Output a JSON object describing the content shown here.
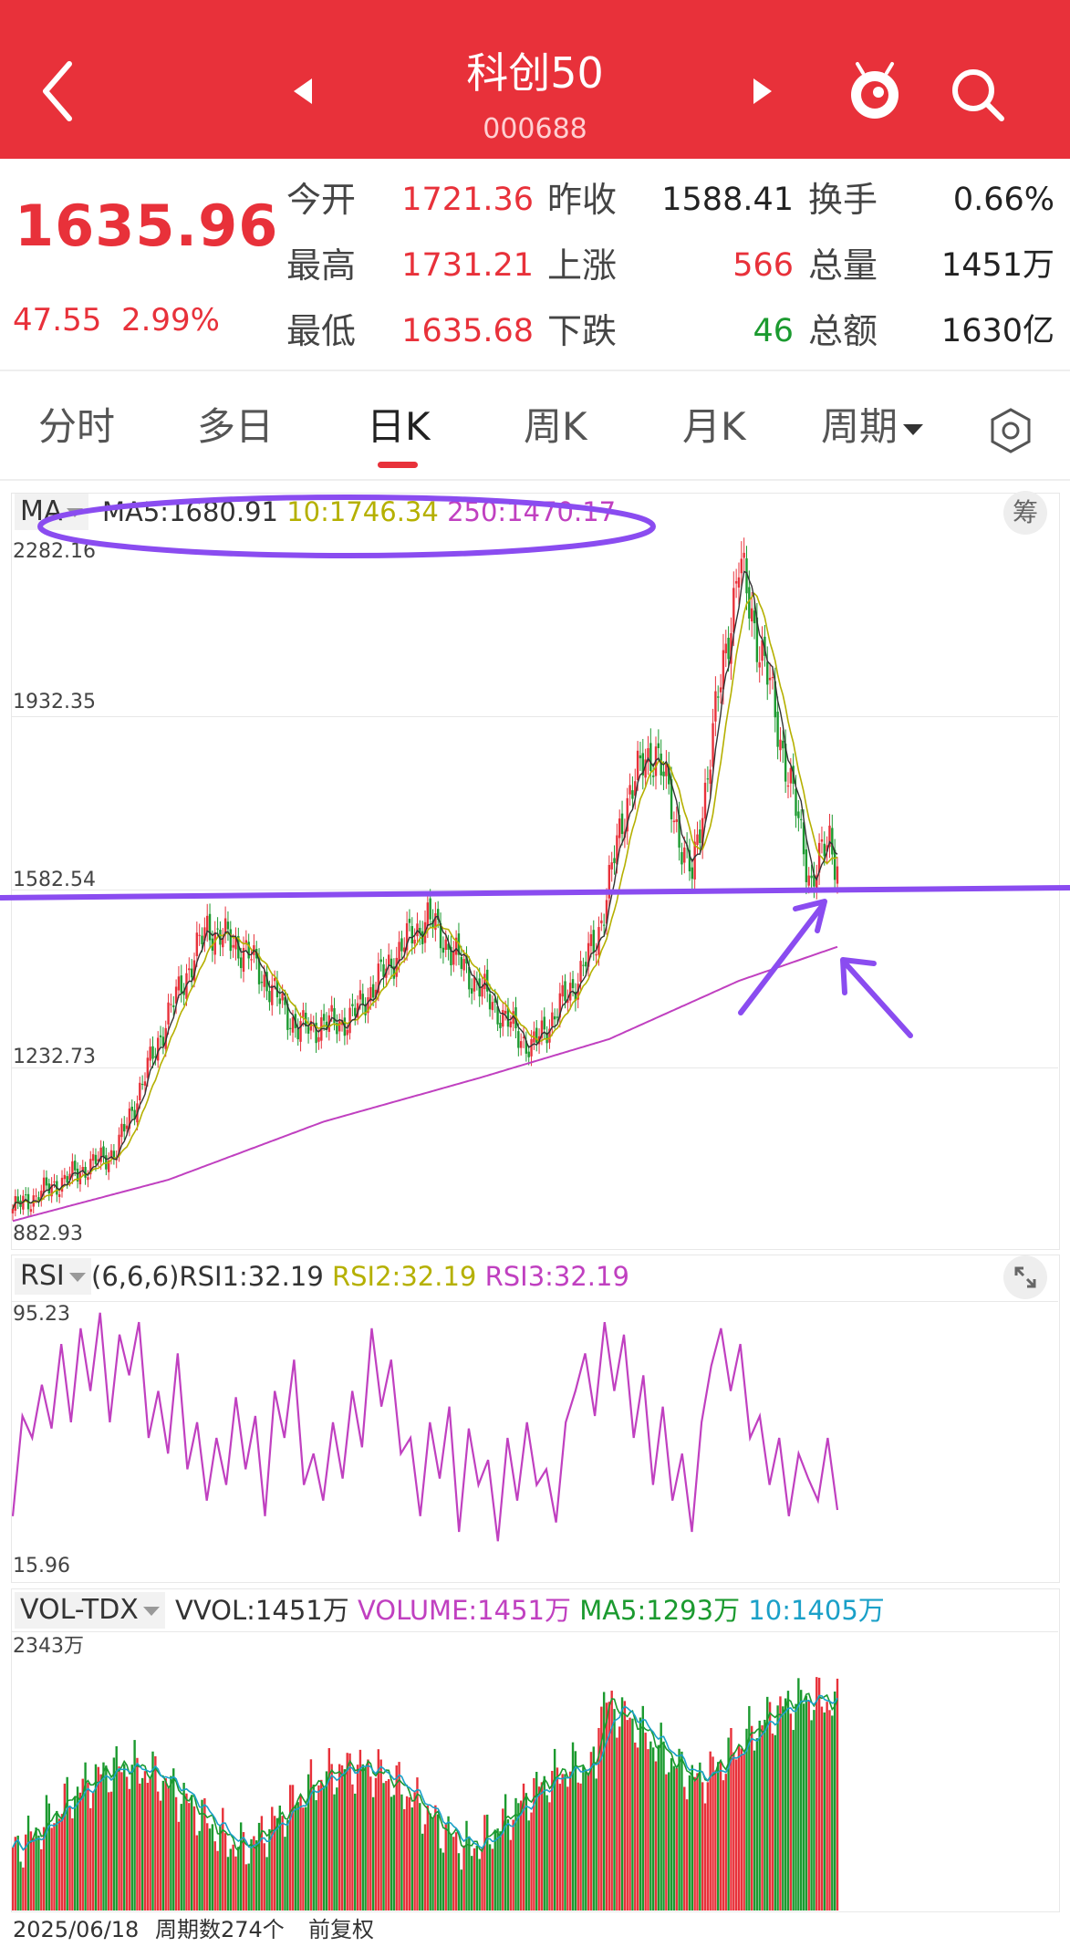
{
  "header": {
    "title": "科创50",
    "code": "000688",
    "bg_color": "#e8313a",
    "back_icon": "back-chevron-icon",
    "prev_icon": "prev-triangle-icon",
    "next_icon": "next-triangle-icon",
    "mascot_icon": "mascot-icon",
    "search_icon": "search-icon"
  },
  "quote": {
    "price": "1635.96",
    "change": "47.55",
    "change_pct": "2.99%",
    "rows": [
      {
        "l1": "今开",
        "v1": "1721.36",
        "l2": "昨收",
        "v2": "1588.41",
        "l3": "换手",
        "v3": "0.66%",
        "c1": "red",
        "c2": "dark",
        "c3": "dark"
      },
      {
        "l1": "最高",
        "v1": "1731.21",
        "l2": "上涨",
        "v2": "566",
        "l3": "总量",
        "v3": "1451万",
        "c1": "red",
        "c2": "red",
        "c3": "dark"
      },
      {
        "l1": "最低",
        "v1": "1635.68",
        "l2": "下跌",
        "v2": "46",
        "l3": "总额",
        "v3": "1630亿",
        "c1": "red",
        "c2": "green",
        "c3": "dark"
      }
    ]
  },
  "tabs": [
    {
      "label": "分时"
    },
    {
      "label": "多日"
    },
    {
      "label": "日K",
      "active": true
    },
    {
      "label": "周K"
    },
    {
      "label": "月K"
    },
    {
      "label": "周期"
    }
  ],
  "tab_settings_icon": "hexagon-settings-icon",
  "kline": {
    "indicator": "MA",
    "legend": {
      "ma5": "MA5:1680.91",
      "ma10": "10:1746.34",
      "ma250": "250:1470.17"
    },
    "chip": "筹",
    "y_ticks": [
      "2282.16",
      "1932.35",
      "1582.54",
      "1232.73",
      "882.93"
    ],
    "colors": {
      "up": "#e8313a",
      "down": "#1b9a2f",
      "ma5": "#333333",
      "ma10": "#b5b000",
      "ma250": "#c040c0",
      "annotation": "#8a4cf0"
    }
  },
  "rsi": {
    "indicator": "RSI",
    "legend": {
      "params": "(6,6,6)",
      "rsi1": "RSI1:32.19",
      "rsi2": "RSI2:32.19",
      "rsi3": "RSI3:32.19"
    },
    "y_ticks": [
      "95.23",
      "15.96"
    ],
    "expand_icon": "expand-icon"
  },
  "vol": {
    "indicator": "VOL-TDX",
    "legend": {
      "vvol": "VVOL:1451万",
      "volume": "VOLUME:1451万",
      "ma5": "MA5:1293万",
      "ma10": "10:1405万"
    },
    "y_top": "2343万"
  },
  "footer": {
    "date": "2025/06/18",
    "period_count": "周期数274个",
    "adjust": "前复权"
  },
  "chart_data": [
    {
      "type": "candlestick",
      "title": "",
      "ylim": [
        882.93,
        2282.16
      ],
      "key_points": [
        {
          "x": 0,
          "close": 930
        },
        {
          "x": 40,
          "close": 1050
        },
        {
          "x": 60,
          "close": 1330
        },
        {
          "x": 75,
          "close": 1510
        },
        {
          "x": 90,
          "close": 1460
        },
        {
          "x": 110,
          "close": 1300
        },
        {
          "x": 130,
          "close": 1320
        },
        {
          "x": 150,
          "close": 1470
        },
        {
          "x": 160,
          "close": 1530
        },
        {
          "x": 175,
          "close": 1420
        },
        {
          "x": 190,
          "close": 1320
        },
        {
          "x": 200,
          "close": 1260
        },
        {
          "x": 215,
          "close": 1380
        },
        {
          "x": 225,
          "close": 1480
        },
        {
          "x": 238,
          "close": 1800
        },
        {
          "x": 248,
          "close": 1880
        },
        {
          "x": 256,
          "close": 1720
        },
        {
          "x": 262,
          "close": 1610
        },
        {
          "x": 270,
          "close": 1910
        },
        {
          "x": 280,
          "close": 2260
        },
        {
          "x": 290,
          "close": 2050
        },
        {
          "x": 300,
          "close": 1800
        },
        {
          "x": 308,
          "close": 1600
        },
        {
          "x": 315,
          "close": 1700
        },
        {
          "x": 318,
          "close": 1635.96
        }
      ],
      "ma250": [
        [
          0,
          905
        ],
        [
          60,
          990
        ],
        [
          120,
          1110
        ],
        [
          180,
          1200
        ],
        [
          230,
          1280
        ],
        [
          280,
          1400
        ],
        [
          318,
          1470.17
        ]
      ]
    },
    {
      "type": "line",
      "title": "RSI",
      "ylim": [
        15.96,
        95.23
      ],
      "values": [
        30,
        62,
        55,
        72,
        58,
        85,
        60,
        90,
        70,
        95,
        60,
        88,
        75,
        92,
        55,
        70,
        50,
        82,
        45,
        60,
        35,
        55,
        40,
        68,
        45,
        62,
        30,
        70,
        55,
        80,
        40,
        50,
        35,
        60,
        42,
        70,
        52,
        90,
        65,
        80,
        50,
        55,
        30,
        60,
        42,
        65,
        25,
        58,
        40,
        48,
        22,
        55,
        35,
        60,
        40,
        45,
        28,
        60,
        70,
        82,
        62,
        92,
        70,
        88,
        55,
        75,
        40,
        65,
        35,
        50,
        25,
        60,
        78,
        90,
        70,
        85,
        55,
        62,
        40,
        55,
        30,
        50,
        42,
        35,
        55,
        32
      ]
    },
    {
      "type": "bar",
      "title": "VOL-TDX",
      "ylim": [
        0,
        2343
      ],
      "unit": "万"
    }
  ]
}
